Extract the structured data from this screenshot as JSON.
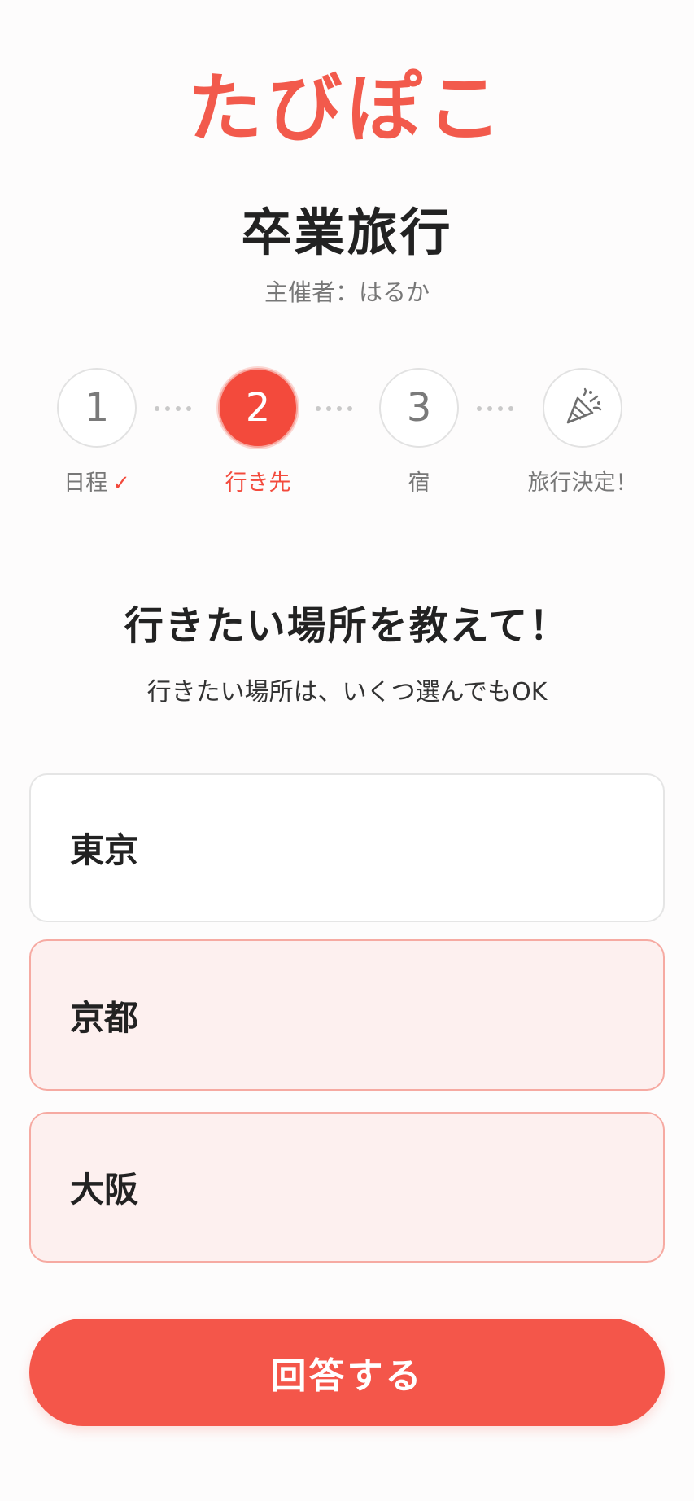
{
  "app": {
    "logo_text": "たびぽこ",
    "brand_color": "#f34a3c"
  },
  "trip": {
    "title": "卒業旅行",
    "organizer": "主催者：はるか"
  },
  "stepper": {
    "steps": [
      {
        "number": "1",
        "label": "日程",
        "state": "done",
        "check_icon": "✓"
      },
      {
        "number": "2",
        "label": "行き先",
        "state": "active"
      },
      {
        "number": "3",
        "label": "宿",
        "state": "pending"
      },
      {
        "icon": "party-popper-icon",
        "label": "旅行決定！",
        "state": "pending"
      }
    ]
  },
  "question": {
    "prompt": "行きたい場所を教えて！",
    "hint": "行きたい場所は、いくつ選んでもOK"
  },
  "options": [
    {
      "label": "東京",
      "selected": false
    },
    {
      "label": "京都",
      "selected": true
    },
    {
      "label": "大阪",
      "selected": true
    }
  ],
  "submit": {
    "label": "回答する"
  }
}
